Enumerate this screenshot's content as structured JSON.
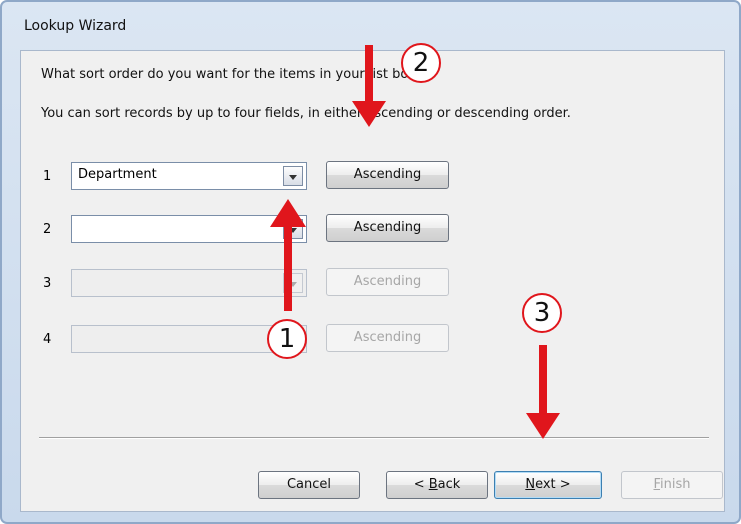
{
  "window": {
    "title": "Lookup Wizard"
  },
  "prompt": {
    "question": "What sort order do you want for the items in your list box?",
    "instruction": "You can sort records by up to four fields, in either ascending or descending order."
  },
  "sort_rows": [
    {
      "number": "1",
      "field": "Department",
      "order": "Ascending",
      "enabled": true
    },
    {
      "number": "2",
      "field": "",
      "order": "Ascending",
      "enabled": true
    },
    {
      "number": "3",
      "field": "",
      "order": "Ascending",
      "enabled": false
    },
    {
      "number": "4",
      "field": "",
      "order": "Ascending",
      "enabled": false
    }
  ],
  "buttons": {
    "cancel": "Cancel",
    "back_prefix": "< ",
    "back_key": "B",
    "back_rest": "ack",
    "next_key": "N",
    "next_rest": "ext >",
    "finish_key": "F",
    "finish_rest": "inish"
  },
  "annotations": {
    "callout_1": "1",
    "callout_2": "2",
    "callout_3": "3"
  },
  "colors": {
    "annotation_red": "#e0161c",
    "dialog_frame": "#c9d9ec",
    "client_bg": "#f0f0f0"
  },
  "icons": {
    "combo_dropdown": "chevron-down-icon"
  }
}
